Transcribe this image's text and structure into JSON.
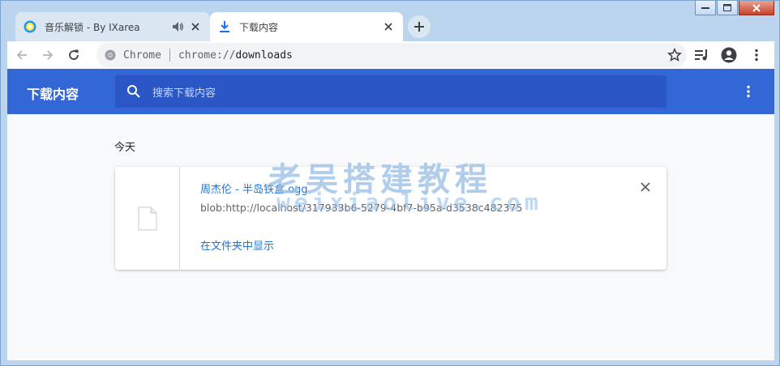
{
  "tabs": [
    {
      "title": "音乐解锁 - By IXarea",
      "icon": "music-unlock-favicon",
      "audio": true
    },
    {
      "title": "下载内容",
      "icon": "download-icon",
      "active": true
    }
  ],
  "toolbar": {
    "omnibox_chip": "Chrome",
    "url_scheme": "chrome://",
    "url_host": "downloads"
  },
  "downloads": {
    "header_title": "下载内容",
    "search_placeholder": "搜索下载内容",
    "day_label": "今天",
    "item": {
      "filename": "周杰伦 - 半岛铁盒.ogg",
      "source": "blob:http://localhost/317933b6-5279-4bf7-b95a-d3538c482375",
      "show_in_folder": "在文件夹中显示"
    }
  },
  "watermark": {
    "line1": "老吴搭建教程",
    "line2": "weixiaolive.com"
  },
  "colors": {
    "accent": "#3367d6",
    "link": "#1a73e8"
  }
}
